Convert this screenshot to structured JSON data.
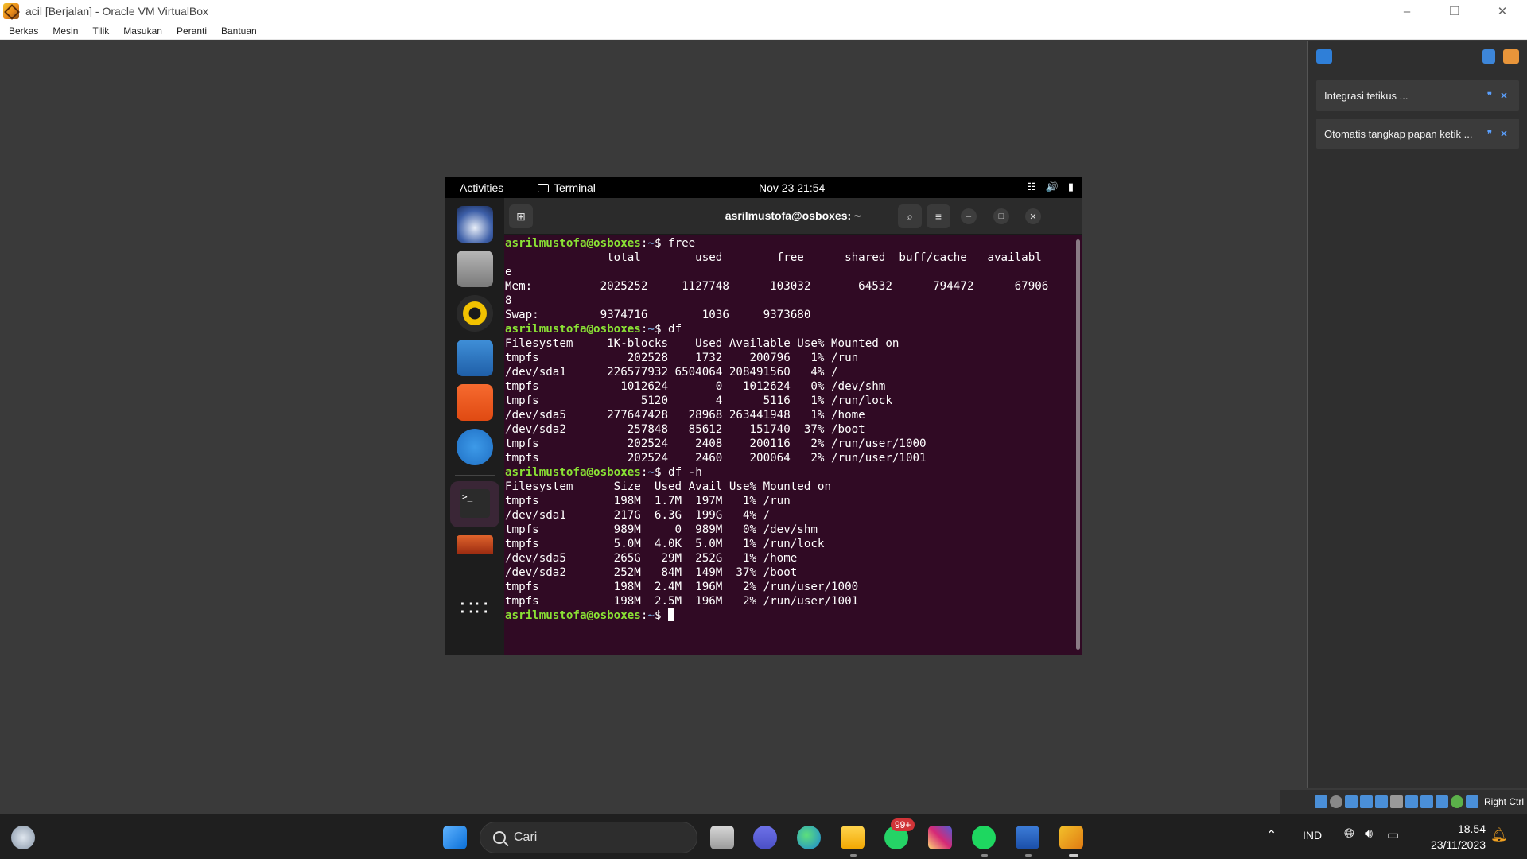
{
  "window": {
    "title": "acil [Berjalan] - Oracle VM VirtualBox",
    "minimize_icon": "minimize-icon",
    "restore_icon": "restore-icon",
    "close_icon": "close-icon"
  },
  "menubar": {
    "items": [
      "Berkas",
      "Mesin",
      "Tilik",
      "Masukan",
      "Peranti",
      "Bantuan"
    ]
  },
  "sidebar": {
    "notifications": [
      {
        "text": "Integrasi tetikus ..."
      },
      {
        "text": "Otomatis tangkap papan ketik ..."
      }
    ]
  },
  "guest": {
    "topbar": {
      "activities": "Activities",
      "app_name": "Terminal",
      "clock": "Nov 23  21:54"
    },
    "terminal": {
      "title": "asrilmustofa@osboxes: ~",
      "prompt_user": "asrilmustofa@osboxes",
      "prompt_path": "~",
      "commands": [
        "free",
        "df",
        "df -h",
        ""
      ],
      "free_output": [
        "               total        used        free      shared  buff/cache   availabl",
        "e",
        "Mem:          2025252     1127748      103032       64532      794472      67906",
        "8",
        "Swap:         9374716        1036     9373680"
      ],
      "df_output": [
        "Filesystem     1K-blocks    Used Available Use% Mounted on",
        "tmpfs             202528    1732    200796   1% /run",
        "/dev/sda1      226577932 6504064 208491560   4% /",
        "tmpfs            1012624       0   1012624   0% /dev/shm",
        "tmpfs               5120       4      5116   1% /run/lock",
        "/dev/sda5      277647428   28968 263441948   1% /home",
        "/dev/sda2         257848   85612    151740  37% /boot",
        "tmpfs             202524    2408    200116   2% /run/user/1000",
        "tmpfs             202524    2460    200064   2% /run/user/1001"
      ],
      "dfh_output": [
        "Filesystem      Size  Used Avail Use% Mounted on",
        "tmpfs           198M  1.7M  197M   1% /run",
        "/dev/sda1       217G  6.3G  199G   4% /",
        "tmpfs           989M     0  989M   0% /dev/shm",
        "tmpfs           5.0M  4.0K  5.0M   1% /run/lock",
        "/dev/sda5       265G   29M  252G   1% /home",
        "/dev/sda2       252M   84M  149M  37% /boot",
        "tmpfs           198M  2.4M  196M   2% /run/user/1000",
        "tmpfs           198M  2.5M  196M   2% /run/user/1001"
      ]
    }
  },
  "vm_status": {
    "host_key": "Right Ctrl"
  },
  "taskbar": {
    "search_placeholder": "Cari",
    "whatsapp_badge": "99+",
    "language": "IND",
    "time": "18.54",
    "date": "23/11/2023"
  },
  "colors": {
    "terminal_bg": "#300a24",
    "prompt_user": "#8ae234",
    "prompt_path": "#729fcf"
  }
}
